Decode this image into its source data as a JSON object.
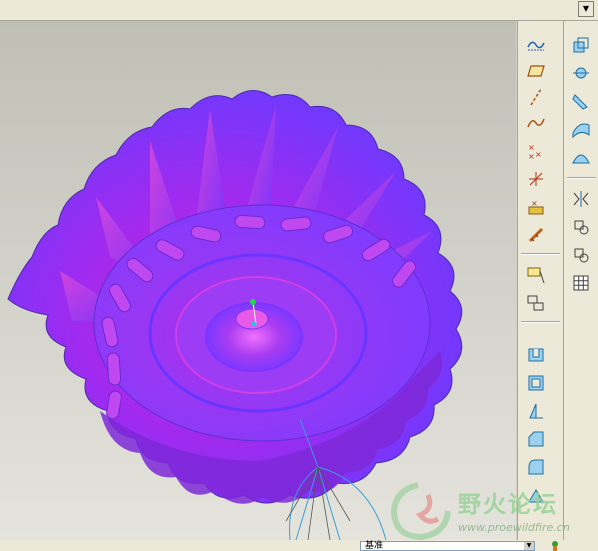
{
  "topbar": {
    "dropdown_icon": "chevron-down-icon"
  },
  "viewport": {
    "model": "purple-fluted-bowl-3d-model",
    "colors": {
      "model_primary": "#7a33ff",
      "model_highlight": "#e020c8",
      "background_top": "#bfbfb5",
      "background_bottom": "#e4e4dc"
    }
  },
  "toolbar_left": {
    "tools": [
      "datum-curve-sketch-icon",
      "datum-plane-icon",
      "datum-axis-icon",
      "datum-curve-icon",
      "datum-point-icon",
      "coordinate-system-icon",
      "analysis-icon",
      "datum-ruler-icon",
      "sketch-tool-icon",
      "sketch-edit-icon",
      "extrude-icon",
      "shell-icon",
      "draft-icon",
      "chamfer-icon",
      "round-icon",
      "rib-icon"
    ]
  },
  "toolbar_right": {
    "tools": [
      "copy-feature-icon",
      "mirror-point-icon",
      "sweep-icon",
      "surface-icon",
      "dome-icon",
      "mirror-icon",
      "pattern-icon",
      "merge-icon",
      "grid-icon"
    ]
  },
  "statusbar": {
    "filter_value": "基准",
    "status_icon": "status-indicator-icon"
  },
  "watermark": {
    "title": "野火论坛",
    "url": "www.proewildfire.cn"
  }
}
